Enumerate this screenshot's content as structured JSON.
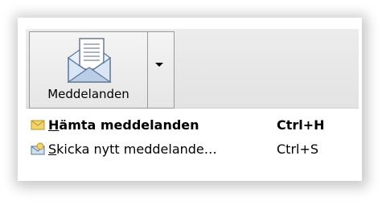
{
  "toolbar": {
    "button_label": "Meddelanden",
    "button_icon": "mail-document-icon",
    "dropdown_icon": "dropdown-arrow-icon"
  },
  "menu": {
    "items": [
      {
        "mnemonic": "H",
        "label_rest": "ämta meddelanden",
        "shortcut": "Ctrl+H",
        "icon": "envelope-icon",
        "bold": true
      },
      {
        "mnemonic": "S",
        "label_rest": "kicka nytt meddelande…",
        "shortcut": "Ctrl+S",
        "icon": "send-envelope-icon",
        "bold": false
      }
    ]
  },
  "colors": {
    "toolbar_bg": "#e6e6e6",
    "button_border": "#9a9a9a",
    "envelope_yellow": "#f3d46a"
  }
}
